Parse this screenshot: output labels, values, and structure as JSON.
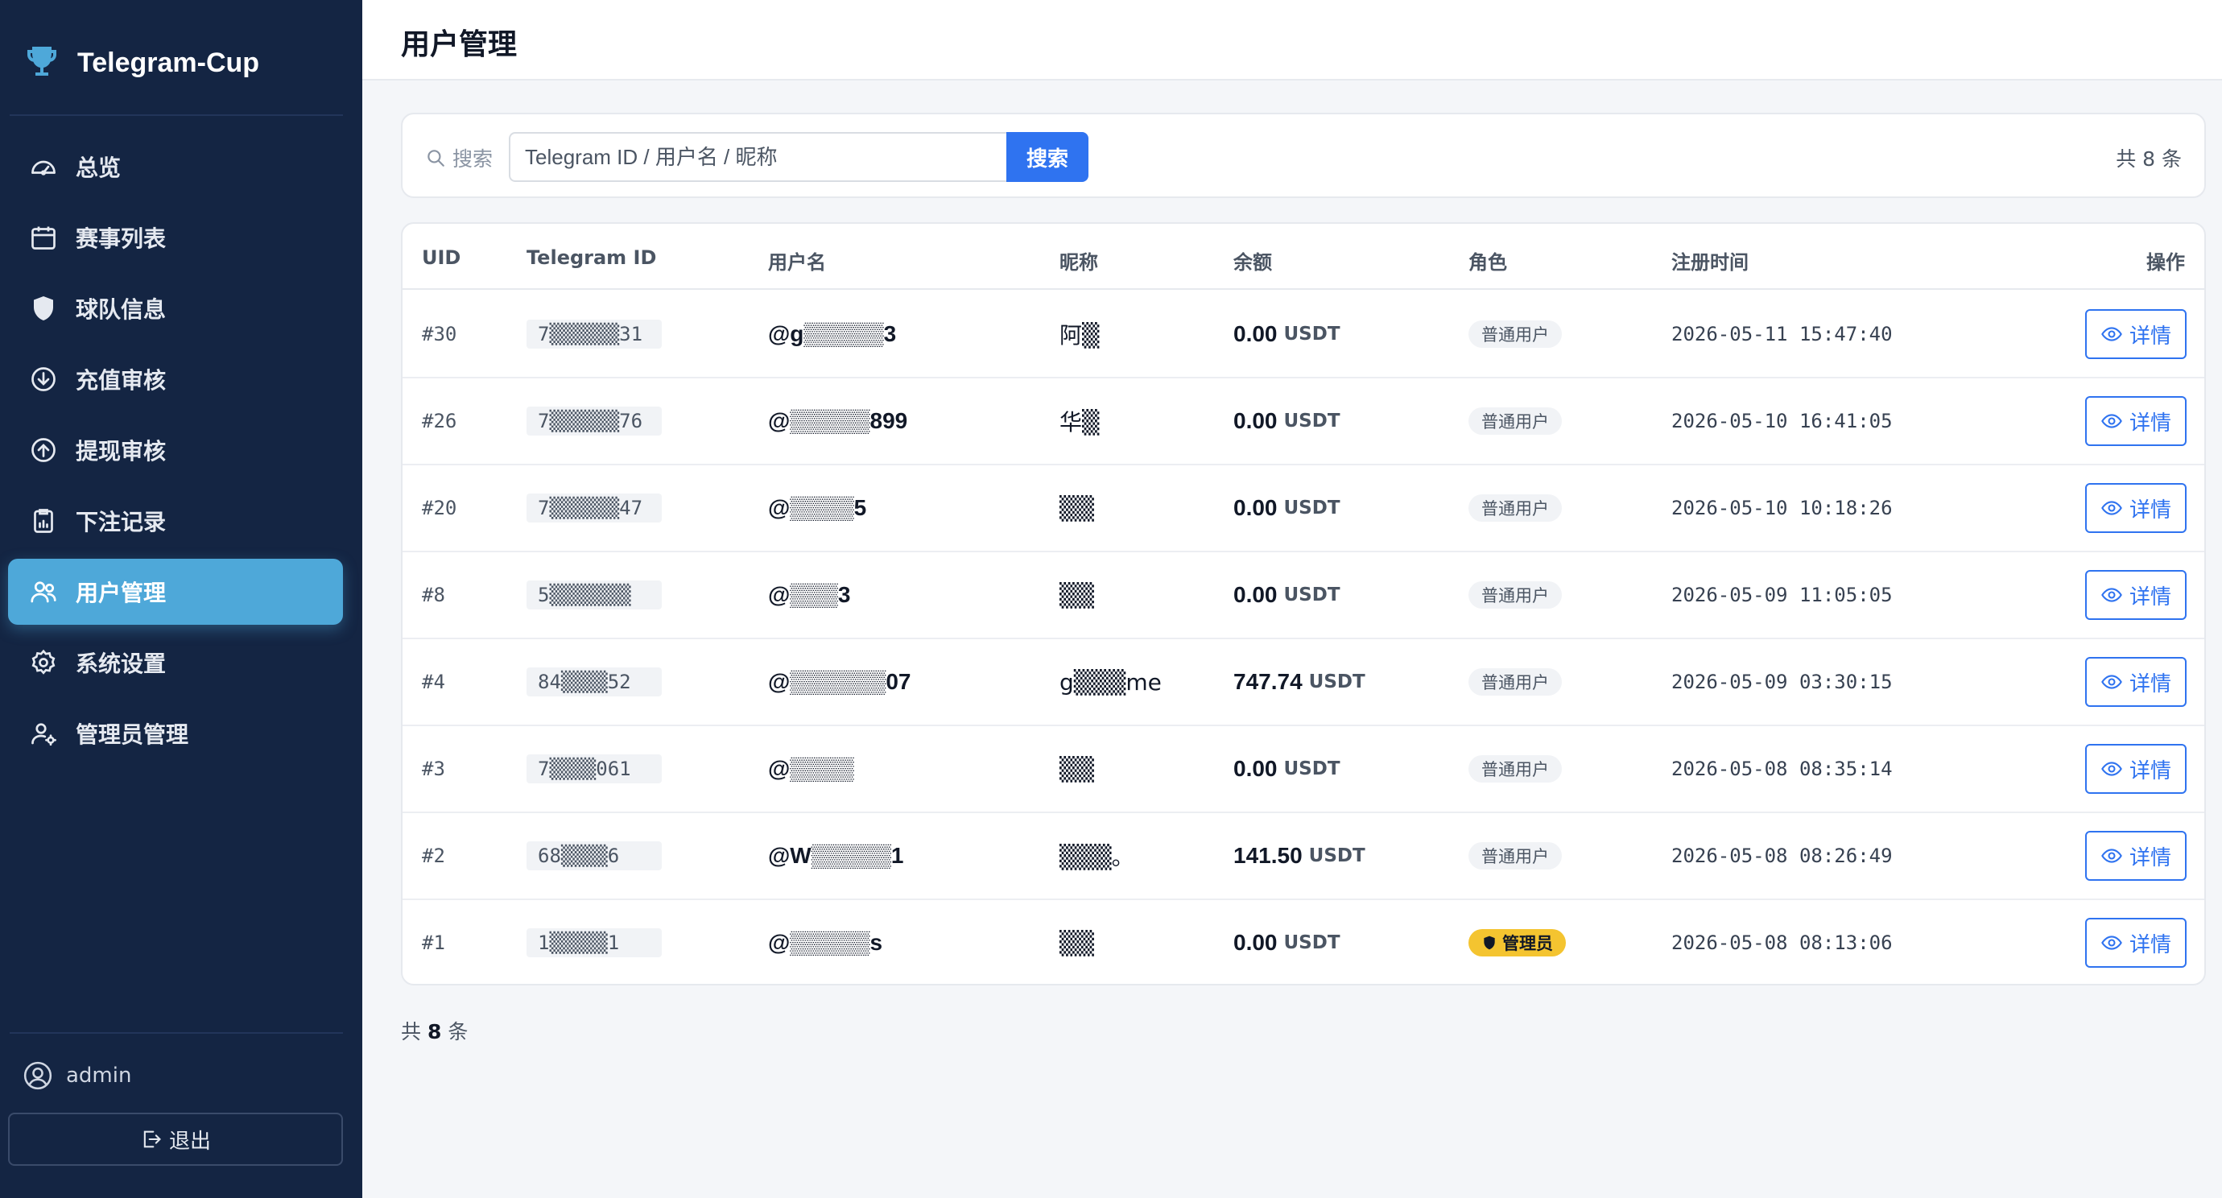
{
  "brand": {
    "title": "Telegram-Cup",
    "icon": "trophy-icon"
  },
  "nav": [
    {
      "label": "总览",
      "icon": "dashboard-icon",
      "active": false
    },
    {
      "label": "赛事列表",
      "icon": "calendar-icon",
      "active": false
    },
    {
      "label": "球队信息",
      "icon": "shield-icon",
      "active": false
    },
    {
      "label": "充值审核",
      "icon": "arrow-down-circle-icon",
      "active": false
    },
    {
      "label": "提现审核",
      "icon": "arrow-up-circle-icon",
      "active": false
    },
    {
      "label": "下注记录",
      "icon": "clipboard-chart-icon",
      "active": false
    },
    {
      "label": "用户管理",
      "icon": "users-icon",
      "active": true
    },
    {
      "label": "系统设置",
      "icon": "gear-icon",
      "active": false
    },
    {
      "label": "管理员管理",
      "icon": "user-gear-icon",
      "active": false
    }
  ],
  "user": {
    "name": "admin"
  },
  "logout_label": "退出",
  "page_title": "用户管理",
  "search": {
    "label": "搜索",
    "placeholder": "Telegram ID / 用户名 / 昵称",
    "button": "搜索",
    "count_text": "共 8 条"
  },
  "table": {
    "headers": {
      "uid": "UID",
      "telegram_id": "Telegram ID",
      "username": "用户名",
      "nickname": "昵称",
      "balance": "余额",
      "role": "角色",
      "registered": "注册时间",
      "actions": "操作"
    },
    "rows": [
      {
        "uid": "#30",
        "telegram_id": "7▒▒▒▒▒▒31",
        "username": "@g▒▒▒▒▒3",
        "nickname": "阿▒",
        "balance": "0.00",
        "unit": "USDT",
        "role": "普通用户",
        "admin": false,
        "registered": "2026-05-11 15:47:40",
        "action": "详情"
      },
      {
        "uid": "#26",
        "telegram_id": "7▒▒▒▒▒▒76",
        "username": "@▒▒▒▒▒899",
        "nickname": "华▒",
        "balance": "0.00",
        "unit": "USDT",
        "role": "普通用户",
        "admin": false,
        "registered": "2026-05-10 16:41:05",
        "action": "详情"
      },
      {
        "uid": "#20",
        "telegram_id": "7▒▒▒▒▒▒47",
        "username": "@▒▒▒▒5",
        "nickname": "▒▒",
        "balance": "0.00",
        "unit": "USDT",
        "role": "普通用户",
        "admin": false,
        "registered": "2026-05-10 10:18:26",
        "action": "详情"
      },
      {
        "uid": "#8",
        "telegram_id": "5▒▒▒▒▒▒▒",
        "username": "@▒▒▒3",
        "nickname": "▒▒",
        "balance": "0.00",
        "unit": "USDT",
        "role": "普通用户",
        "admin": false,
        "registered": "2026-05-09 11:05:05",
        "action": "详情"
      },
      {
        "uid": "#4",
        "telegram_id": "84▒▒▒▒52",
        "username": "@▒▒▒▒▒▒07",
        "nickname": "g▒▒▒me",
        "balance": "747.74",
        "unit": "USDT",
        "role": "普通用户",
        "admin": false,
        "registered": "2026-05-09 03:30:15",
        "action": "详情"
      },
      {
        "uid": "#3",
        "telegram_id": "7▒▒▒▒061",
        "username": "@▒▒▒▒",
        "nickname": "▒▒",
        "balance": "0.00",
        "unit": "USDT",
        "role": "普通用户",
        "admin": false,
        "registered": "2026-05-08 08:35:14",
        "action": "详情"
      },
      {
        "uid": "#2",
        "telegram_id": "68▒▒▒▒6",
        "username": "@W▒▒▒▒▒1",
        "nickname": "▒▒▒。",
        "balance": "141.50",
        "unit": "USDT",
        "role": "普通用户",
        "admin": false,
        "registered": "2026-05-08 08:26:49",
        "action": "详情"
      },
      {
        "uid": "#1",
        "telegram_id": "1▒▒▒▒▒1",
        "username": "@▒▒▒▒▒s",
        "nickname": "▒▒",
        "balance": "0.00",
        "unit": "USDT",
        "role": "管理员",
        "admin": true,
        "registered": "2026-05-08 08:13:06",
        "action": "详情"
      }
    ]
  },
  "footer": {
    "prefix": "共",
    "count": "8",
    "suffix": "条"
  },
  "colors": {
    "sidebar_bg": "#142543",
    "active_nav": "#4ea8d9",
    "primary": "#2f73f0",
    "admin_badge": "#f4c430"
  }
}
